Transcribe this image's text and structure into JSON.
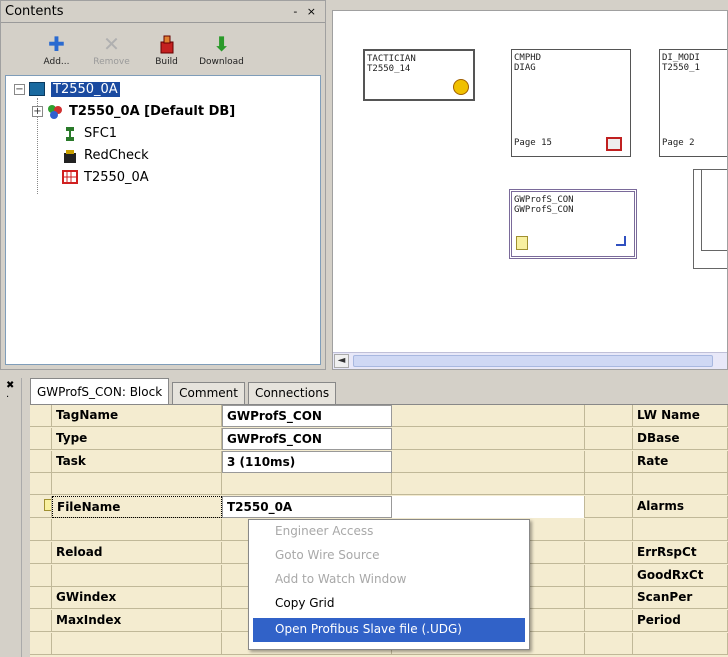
{
  "contents": {
    "title": "Contents",
    "controls": "- ×",
    "toolbar": [
      {
        "label": "Add...",
        "icon": "add-icon",
        "enabled": true
      },
      {
        "label": "Remove",
        "icon": "remove-icon",
        "enabled": false
      },
      {
        "label": "Build",
        "icon": "build-icon",
        "enabled": true
      },
      {
        "label": "Download",
        "icon": "download-icon",
        "enabled": true
      }
    ],
    "tree": {
      "root": "T2550_0A",
      "items": [
        "T2550_0A [Default DB]",
        "SFC1",
        "RedCheck",
        "T2550_0A"
      ]
    }
  },
  "canvas": {
    "blocks": [
      {
        "lines": [
          "TACTICIAN",
          "T2550_14"
        ]
      },
      {
        "lines": [
          "CMPHD",
          "DIAG"
        ],
        "footer": "Page 15"
      },
      {
        "lines": [
          "DI_MODI",
          "T2550_1"
        ],
        "footer": "Page 2"
      },
      {
        "lines": [
          "GWProfS_CON",
          "GWProfS_CON"
        ]
      }
    ]
  },
  "tabs": [
    "GWProfS_CON: Block",
    "Comment",
    "Connections"
  ],
  "grid": {
    "rows": [
      {
        "name": "TagName",
        "value": "GWProfS_CON",
        "right": "LW Name"
      },
      {
        "name": "Type",
        "value": "GWProfS_CON",
        "right": "DBase"
      },
      {
        "name": "Task",
        "value": "3 (110ms)",
        "right": "Rate"
      },
      {
        "name": "",
        "value": "",
        "right": ""
      },
      {
        "name": "FileName",
        "value": "T2550_0A",
        "right": "Alarms"
      },
      {
        "name": "",
        "value": "",
        "right": ""
      },
      {
        "name": "Reload",
        "value": "",
        "right": "ErrRspCt"
      },
      {
        "name": "",
        "value": "",
        "right": "GoodRxCt"
      },
      {
        "name": "GWindex",
        "value": "",
        "right": "ScanPer"
      },
      {
        "name": "MaxIndex",
        "value": "",
        "right": "Period"
      },
      {
        "name": "",
        "value": "",
        "right": ""
      }
    ]
  },
  "context_menu": {
    "items": [
      {
        "label": "Engineer Access",
        "enabled": false
      },
      {
        "label": "Goto Wire Source",
        "enabled": false
      },
      {
        "label": "Add to Watch Window",
        "enabled": false
      },
      {
        "label": "Copy Grid",
        "enabled": true
      },
      {
        "label": "Open Profibus Slave file (.UDG)",
        "enabled": true,
        "highlighted": true
      }
    ]
  }
}
